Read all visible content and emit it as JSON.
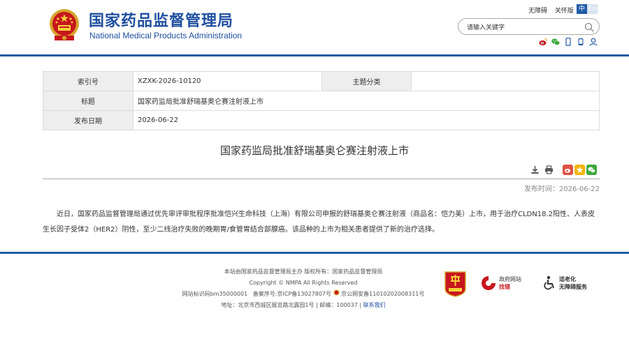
{
  "header": {
    "title_cn": "国家药品监督管理局",
    "title_en": "National Medical Products Administration",
    "top_links": [
      "无障碍",
      "关怀版"
    ],
    "lang": [
      "中",
      "En"
    ],
    "search_placeholder": "请输入关键字"
  },
  "meta": {
    "index_label": "索引号",
    "index_value": "XZXK-2026-10120",
    "category_label": "主题分类",
    "category_value": "",
    "title_label": "标题",
    "title_value": "国家药监局批准舒瑞基奥仑赛注射液上市",
    "date_label": "发布日期",
    "date_value": "2026-06-22"
  },
  "article": {
    "title": "国家药监局批准舒瑞基奥仑赛注射液上市",
    "pubtime": "发布时间：2026-06-22",
    "body": "近日，国家药品监督管理局通过优先审评审批程序批准恺兴生命科技（上海）有限公司申报的舒瑞基奥仑赛注射液（商品名：恺力美）上市，用于治疗CLDN18.2阳性、人表皮生长因子受体2（HER2）阴性，至少二线治疗失败的晚期胃/食管胃结合部腺癌。该品种的上市为相关患者提供了新的治疗选择。"
  },
  "footer": {
    "line1": "本站由国家药品监督管理局主办 版权所有：国家药品监督管理局",
    "line2": "Copyright © NMPA All Rights Reserved",
    "line3a": "网站标识码bm35000001",
    "line3b": "备案序号:京ICP备13027807号",
    "line3c": "京公网安备11010202008311号",
    "line4a": "地址：北京市西城区展览路北露园1号 | 邮编：100037 |",
    "line4b": "联系我们",
    "badge_gov_line1": "政府网站",
    "badge_gov_line2": "找错",
    "badge_access_line1": "适老化",
    "badge_access_line2": "无障碍服务"
  },
  "colors": {
    "brand_blue": "#1f5ba8",
    "title_blue": "#1f4fa0",
    "red": "#c8161d"
  }
}
